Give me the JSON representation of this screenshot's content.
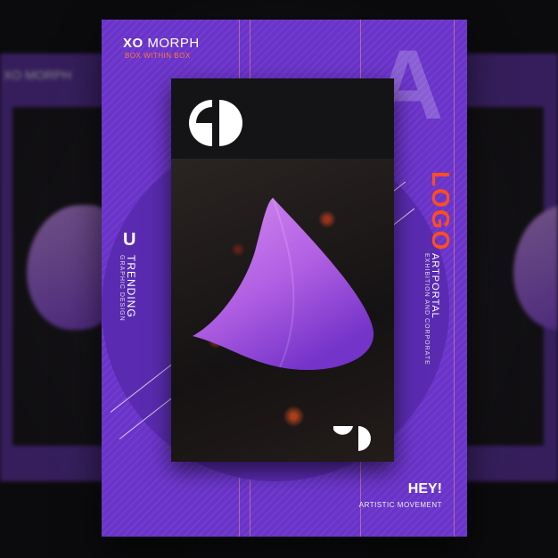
{
  "poster": {
    "title_bold": "XO",
    "title_rest": "MORPH",
    "subtitle": "BOX WITHIN BOX",
    "big_letter": "A",
    "u_letter": "U",
    "trending": "TRENDING",
    "graphic_design": "GRAPHIC DESIGN",
    "logo_word": "LOGO",
    "artportal": "ARTPORTAL",
    "exhibition": "EXHIBITION AND CORPORATE",
    "hey": "HEY!",
    "artistic": "ARTISTIC MOVEMENT"
  },
  "ghost_left": {
    "title": "XO MORPH"
  },
  "colors": {
    "purple": "#6a33c9",
    "accent_orange": "#ff4d1f",
    "card_black": "#141315",
    "shape_gradient_top": "#c57fe8",
    "shape_gradient_bottom": "#8b3fd6"
  },
  "icons": [
    "g-logo-mark",
    "small-logo-mark",
    "morph-cone-shape"
  ]
}
